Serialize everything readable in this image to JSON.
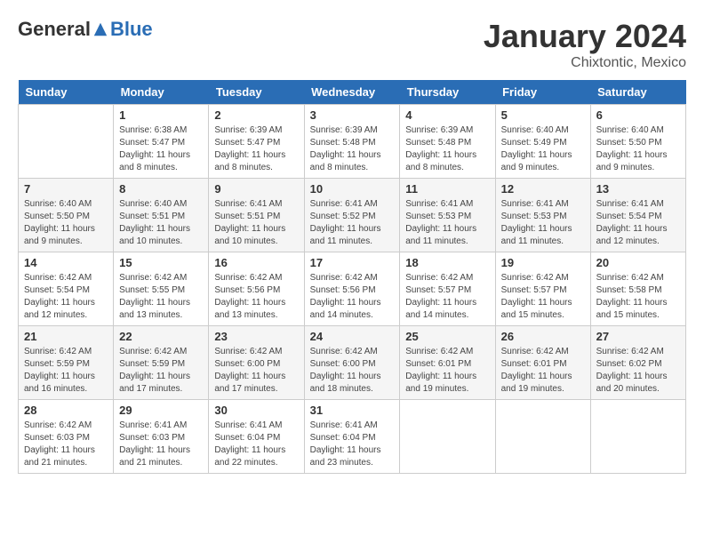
{
  "logo": {
    "general": "General",
    "blue": "Blue"
  },
  "title": "January 2024",
  "location": "Chixtontic, Mexico",
  "days_of_week": [
    "Sunday",
    "Monday",
    "Tuesday",
    "Wednesday",
    "Thursday",
    "Friday",
    "Saturday"
  ],
  "weeks": [
    [
      {
        "day": "",
        "sunrise": "",
        "sunset": "",
        "daylight": ""
      },
      {
        "day": "1",
        "sunrise": "Sunrise: 6:38 AM",
        "sunset": "Sunset: 5:47 PM",
        "daylight": "Daylight: 11 hours and 8 minutes."
      },
      {
        "day": "2",
        "sunrise": "Sunrise: 6:39 AM",
        "sunset": "Sunset: 5:47 PM",
        "daylight": "Daylight: 11 hours and 8 minutes."
      },
      {
        "day": "3",
        "sunrise": "Sunrise: 6:39 AM",
        "sunset": "Sunset: 5:48 PM",
        "daylight": "Daylight: 11 hours and 8 minutes."
      },
      {
        "day": "4",
        "sunrise": "Sunrise: 6:39 AM",
        "sunset": "Sunset: 5:48 PM",
        "daylight": "Daylight: 11 hours and 8 minutes."
      },
      {
        "day": "5",
        "sunrise": "Sunrise: 6:40 AM",
        "sunset": "Sunset: 5:49 PM",
        "daylight": "Daylight: 11 hours and 9 minutes."
      },
      {
        "day": "6",
        "sunrise": "Sunrise: 6:40 AM",
        "sunset": "Sunset: 5:50 PM",
        "daylight": "Daylight: 11 hours and 9 minutes."
      }
    ],
    [
      {
        "day": "7",
        "sunrise": "Sunrise: 6:40 AM",
        "sunset": "Sunset: 5:50 PM",
        "daylight": "Daylight: 11 hours and 9 minutes."
      },
      {
        "day": "8",
        "sunrise": "Sunrise: 6:40 AM",
        "sunset": "Sunset: 5:51 PM",
        "daylight": "Daylight: 11 hours and 10 minutes."
      },
      {
        "day": "9",
        "sunrise": "Sunrise: 6:41 AM",
        "sunset": "Sunset: 5:51 PM",
        "daylight": "Daylight: 11 hours and 10 minutes."
      },
      {
        "day": "10",
        "sunrise": "Sunrise: 6:41 AM",
        "sunset": "Sunset: 5:52 PM",
        "daylight": "Daylight: 11 hours and 11 minutes."
      },
      {
        "day": "11",
        "sunrise": "Sunrise: 6:41 AM",
        "sunset": "Sunset: 5:53 PM",
        "daylight": "Daylight: 11 hours and 11 minutes."
      },
      {
        "day": "12",
        "sunrise": "Sunrise: 6:41 AM",
        "sunset": "Sunset: 5:53 PM",
        "daylight": "Daylight: 11 hours and 11 minutes."
      },
      {
        "day": "13",
        "sunrise": "Sunrise: 6:41 AM",
        "sunset": "Sunset: 5:54 PM",
        "daylight": "Daylight: 11 hours and 12 minutes."
      }
    ],
    [
      {
        "day": "14",
        "sunrise": "Sunrise: 6:42 AM",
        "sunset": "Sunset: 5:54 PM",
        "daylight": "Daylight: 11 hours and 12 minutes."
      },
      {
        "day": "15",
        "sunrise": "Sunrise: 6:42 AM",
        "sunset": "Sunset: 5:55 PM",
        "daylight": "Daylight: 11 hours and 13 minutes."
      },
      {
        "day": "16",
        "sunrise": "Sunrise: 6:42 AM",
        "sunset": "Sunset: 5:56 PM",
        "daylight": "Daylight: 11 hours and 13 minutes."
      },
      {
        "day": "17",
        "sunrise": "Sunrise: 6:42 AM",
        "sunset": "Sunset: 5:56 PM",
        "daylight": "Daylight: 11 hours and 14 minutes."
      },
      {
        "day": "18",
        "sunrise": "Sunrise: 6:42 AM",
        "sunset": "Sunset: 5:57 PM",
        "daylight": "Daylight: 11 hours and 14 minutes."
      },
      {
        "day": "19",
        "sunrise": "Sunrise: 6:42 AM",
        "sunset": "Sunset: 5:57 PM",
        "daylight": "Daylight: 11 hours and 15 minutes."
      },
      {
        "day": "20",
        "sunrise": "Sunrise: 6:42 AM",
        "sunset": "Sunset: 5:58 PM",
        "daylight": "Daylight: 11 hours and 15 minutes."
      }
    ],
    [
      {
        "day": "21",
        "sunrise": "Sunrise: 6:42 AM",
        "sunset": "Sunset: 5:59 PM",
        "daylight": "Daylight: 11 hours and 16 minutes."
      },
      {
        "day": "22",
        "sunrise": "Sunrise: 6:42 AM",
        "sunset": "Sunset: 5:59 PM",
        "daylight": "Daylight: 11 hours and 17 minutes."
      },
      {
        "day": "23",
        "sunrise": "Sunrise: 6:42 AM",
        "sunset": "Sunset: 6:00 PM",
        "daylight": "Daylight: 11 hours and 17 minutes."
      },
      {
        "day": "24",
        "sunrise": "Sunrise: 6:42 AM",
        "sunset": "Sunset: 6:00 PM",
        "daylight": "Daylight: 11 hours and 18 minutes."
      },
      {
        "day": "25",
        "sunrise": "Sunrise: 6:42 AM",
        "sunset": "Sunset: 6:01 PM",
        "daylight": "Daylight: 11 hours and 19 minutes."
      },
      {
        "day": "26",
        "sunrise": "Sunrise: 6:42 AM",
        "sunset": "Sunset: 6:01 PM",
        "daylight": "Daylight: 11 hours and 19 minutes."
      },
      {
        "day": "27",
        "sunrise": "Sunrise: 6:42 AM",
        "sunset": "Sunset: 6:02 PM",
        "daylight": "Daylight: 11 hours and 20 minutes."
      }
    ],
    [
      {
        "day": "28",
        "sunrise": "Sunrise: 6:42 AM",
        "sunset": "Sunset: 6:03 PM",
        "daylight": "Daylight: 11 hours and 21 minutes."
      },
      {
        "day": "29",
        "sunrise": "Sunrise: 6:41 AM",
        "sunset": "Sunset: 6:03 PM",
        "daylight": "Daylight: 11 hours and 21 minutes."
      },
      {
        "day": "30",
        "sunrise": "Sunrise: 6:41 AM",
        "sunset": "Sunset: 6:04 PM",
        "daylight": "Daylight: 11 hours and 22 minutes."
      },
      {
        "day": "31",
        "sunrise": "Sunrise: 6:41 AM",
        "sunset": "Sunset: 6:04 PM",
        "daylight": "Daylight: 11 hours and 23 minutes."
      },
      {
        "day": "",
        "sunrise": "",
        "sunset": "",
        "daylight": ""
      },
      {
        "day": "",
        "sunrise": "",
        "sunset": "",
        "daylight": ""
      },
      {
        "day": "",
        "sunrise": "",
        "sunset": "",
        "daylight": ""
      }
    ]
  ]
}
